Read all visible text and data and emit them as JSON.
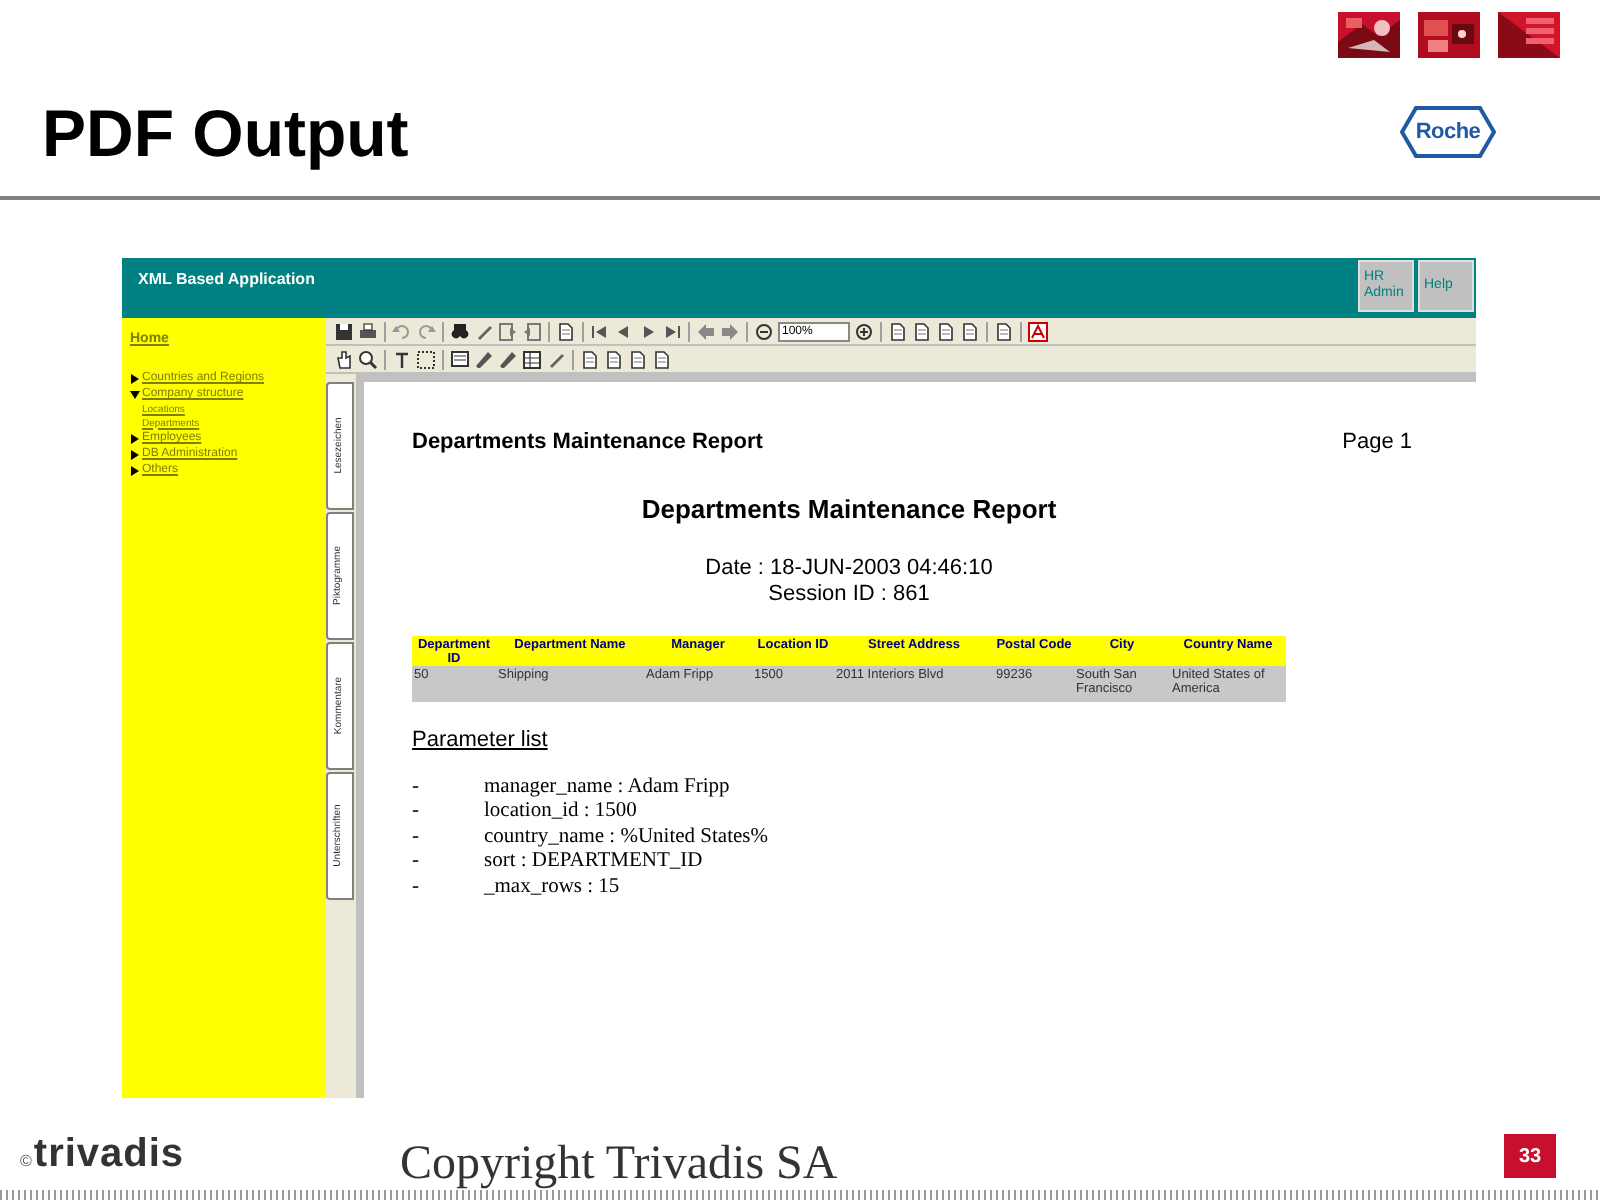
{
  "slide": {
    "title": "PDF Output",
    "brand": "Roche",
    "logo_mark": "©",
    "logo": "trivadis",
    "copyright": "Copyright Trivadis SA",
    "page_number": "33"
  },
  "app": {
    "title": "XML Based Application",
    "header_buttons": [
      "HR Admin",
      "Help"
    ],
    "nav": {
      "home": "Home",
      "items": [
        {
          "label": "Countries and Regions",
          "expanded": false
        },
        {
          "label": "Company structure",
          "expanded": true,
          "children": [
            {
              "label": "Locations"
            },
            {
              "label": "Departments"
            }
          ]
        },
        {
          "label": "Employees",
          "expanded": false
        },
        {
          "label": "DB Administration",
          "expanded": false
        },
        {
          "label": "Others",
          "expanded": false
        }
      ]
    },
    "viewer": {
      "zoom": "100%",
      "side_tabs": [
        "Lesezeichen",
        "Piktogramme",
        "Kommentare",
        "Unterschriften"
      ],
      "report": {
        "header": "Departments Maintenance Report",
        "page": "Page 1",
        "title": "Departments Maintenance Report",
        "date": "Date : 18-JUN-2003 04:46:10",
        "session": "Session ID : 861",
        "columns": [
          "Department ID",
          "Department Name",
          "Manager",
          "Location ID",
          "Street Address",
          "Postal Code",
          "City",
          "Country Name"
        ],
        "rows": [
          [
            "50",
            "Shipping",
            "Adam Fripp",
            "1500",
            "2011 Interiors Blvd",
            "99236",
            "South San Francisco",
            "United States of America"
          ]
        ],
        "parameter_title": "Parameter list",
        "parameters": [
          {
            "bullet": "-",
            "text": "manager_name : Adam Fripp"
          },
          {
            "bullet": "-",
            "text": "location_id : 1500"
          },
          {
            "bullet": "-",
            "text": "country_name : %United States%"
          },
          {
            "bullet": "-",
            "text": "sort : DEPARTMENT_ID"
          },
          {
            "bullet": "-",
            "text": "_max_rows : 15"
          }
        ]
      }
    }
  }
}
